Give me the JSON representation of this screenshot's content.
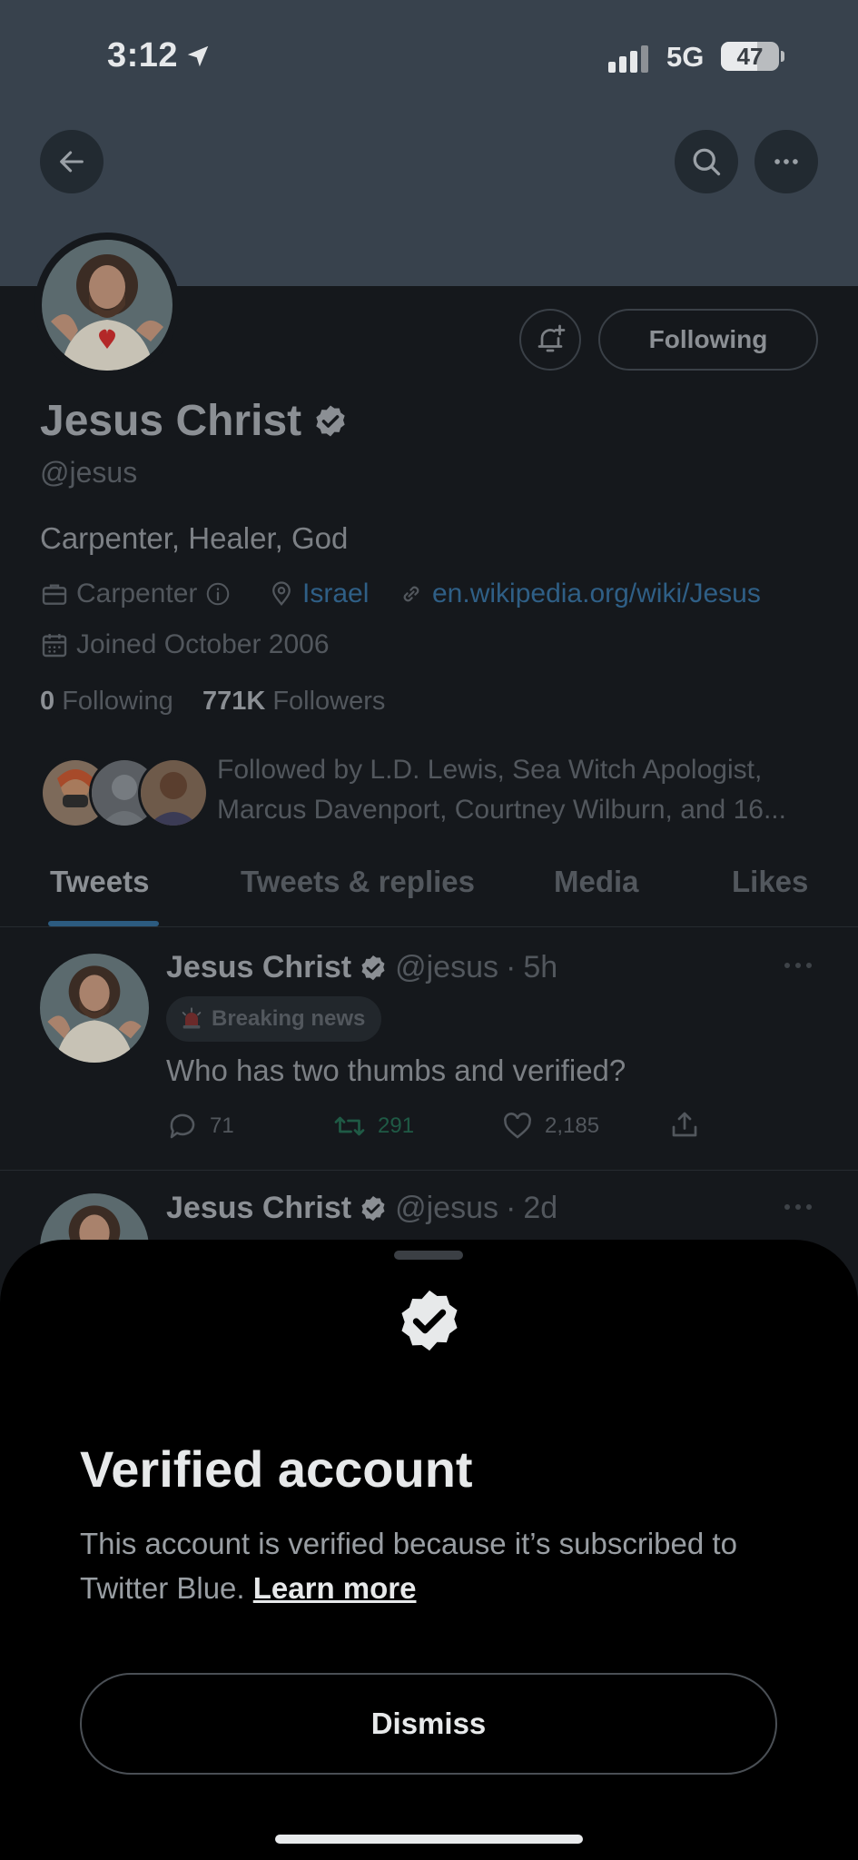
{
  "status": {
    "time": "3:12",
    "network": "5G",
    "battery": "47"
  },
  "header": {
    "back_icon": "arrow-left-icon",
    "search_icon": "search-icon",
    "more_icon": "more-icon"
  },
  "profile": {
    "follow_button": "Following",
    "name": "Jesus Christ",
    "handle": "@jesus",
    "bio": "Carpenter, Healer, God",
    "profession": "Carpenter",
    "location": "Israel",
    "website": "en.wikipedia.org/wiki/Jesus",
    "joined": "Joined October 2006",
    "following_count": "0",
    "following_label": "Following",
    "followers_count": "771K",
    "followers_label": "Followers",
    "followed_by": "Followed by L.D. Lewis, Sea Witch Apologist, Marcus Davenport, Courtney Wilburn, and 16..."
  },
  "tabs": [
    "Tweets",
    "Tweets & replies",
    "Media",
    "Likes"
  ],
  "tweets": [
    {
      "name": "Jesus Christ",
      "handle": "@jesus",
      "time": "5h",
      "label": "Breaking news",
      "text": "Who has two thumbs and verified?",
      "replies": "71",
      "retweets": "291",
      "likes": "2,185"
    },
    {
      "name": "Jesus Christ",
      "handle": "@jesus",
      "time": "2d"
    }
  ],
  "sheet": {
    "title": "Verified account",
    "body": "This account is verified because it’s subscribed to Twitter Blue.",
    "learn_more": "Learn more",
    "dismiss": "Dismiss"
  },
  "colors": {
    "accent": "#1d9bf0",
    "retweet": "#00ba7c"
  }
}
